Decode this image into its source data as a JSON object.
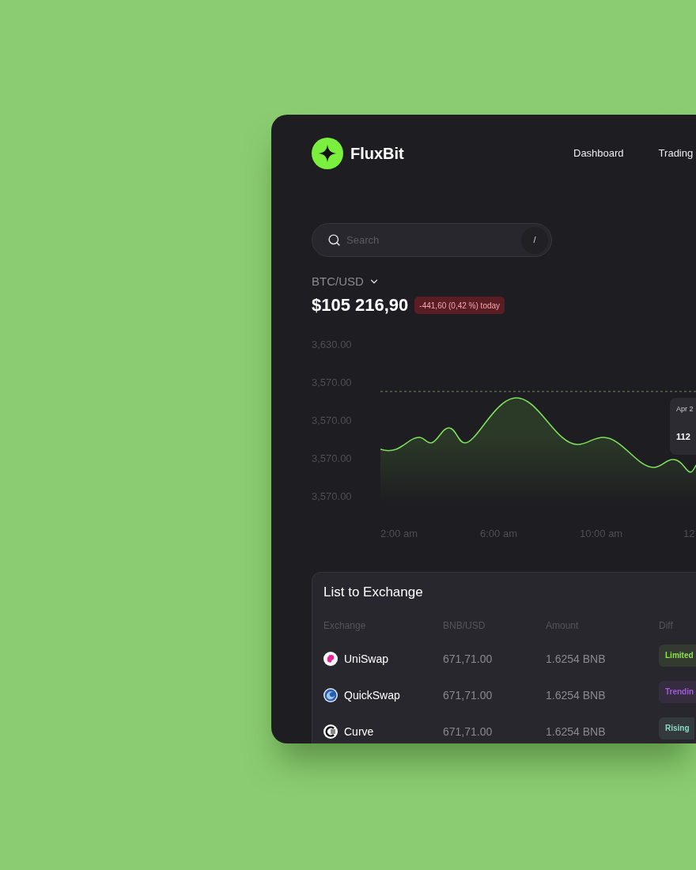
{
  "brand": {
    "name": "FluxBit"
  },
  "nav": [
    {
      "label": "Dashboard"
    },
    {
      "label": "Trading"
    }
  ],
  "search": {
    "placeholder": "Search",
    "shortcut": "/"
  },
  "ticker": {
    "pair": "BTC/USD",
    "price": "$105 216,90",
    "change": "-441,60 (0,42 %) today"
  },
  "chart": {
    "y_labels": [
      "3,630.00",
      "3,570.00",
      "3,570.00",
      "3,570.00",
      "3,570.00"
    ],
    "x_labels": [
      "2:00 am",
      "6:00 am",
      "10:00 am",
      "12"
    ],
    "tooltip": {
      "date": "Apr 2",
      "value": "112"
    }
  },
  "exchange_list": {
    "title": "List to Exchange",
    "columns": [
      "Exchange",
      "BNB/USD",
      "Amount",
      "Diff"
    ],
    "rows": [
      {
        "exchange": "UniSwap",
        "price": "671,71.00",
        "amount": "1.6254 BNB",
        "diff": {
          "label": "Limited",
          "color": "#8ee24e"
        }
      },
      {
        "exchange": "QuickSwap",
        "price": "671,71.00",
        "amount": "1.6254 BNB",
        "diff": {
          "label": "Trendin",
          "color": "#a25ad6"
        }
      },
      {
        "exchange": "Curve",
        "price": "671,71.00",
        "amount": "1.6254 BNB",
        "diff": {
          "label": "Rising",
          "color": "#8fd8c6"
        }
      }
    ]
  }
}
